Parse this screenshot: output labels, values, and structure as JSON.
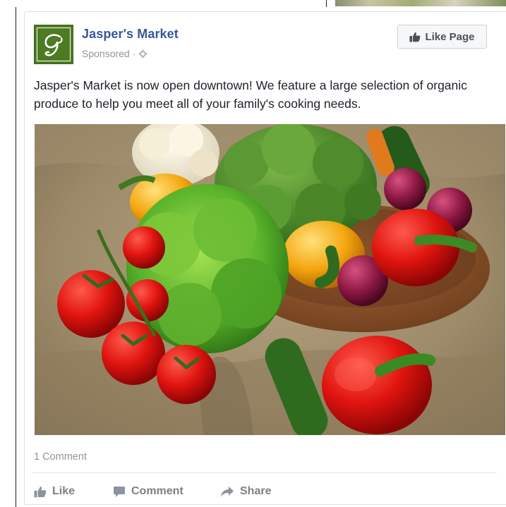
{
  "post": {
    "page_name": "Jasper's Market",
    "sponsored_label": "Sponsored",
    "sponsored_separator": "·",
    "like_page_label": "Like Page",
    "text": "Jasper's Market is now open downtown! We feature a large selection of organic produce to help you meet all of your family's cooking needs.",
    "comment_count": "1 Comment",
    "actions": {
      "like": "Like",
      "comment": "Comment",
      "share": "Share"
    },
    "logo_color": "#4d7a22",
    "link_color": "#365899"
  },
  "icons": {
    "like_page": "thumbs-up-icon",
    "sponsored_globe": "gear-icon",
    "like": "thumbs-up-icon",
    "comment": "speech-bubble-icon",
    "share": "share-arrow-icon"
  }
}
